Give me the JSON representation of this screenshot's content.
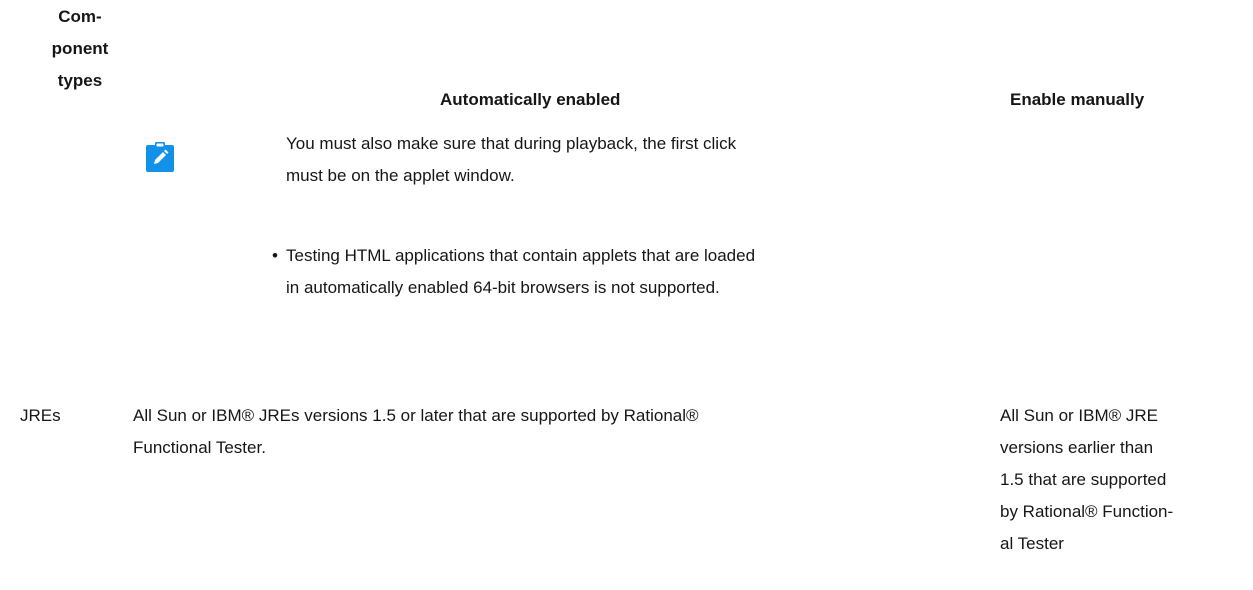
{
  "table": {
    "headers": {
      "component_types": [
        "Com-",
        "ponent",
        "types"
      ],
      "automatically_enabled": "Automatically enabled",
      "enable_manually": "Enable manually"
    },
    "note": {
      "icon": "pencil-note-icon",
      "icon_color": "#1192e8",
      "lines": [
        "You must also make sure that during playback, the first click",
        "must be on the applet window."
      ]
    },
    "bullet": {
      "marker": "•",
      "lines": [
        "Testing HTML applications that contain applets that are loaded",
        "in automatically enabled 64-bit browsers is not supported."
      ]
    },
    "rows": [
      {
        "type": "JREs",
        "auto_lines": [
          "All Sun or IBM® JREs versions 1.5 or later that are supported by Rational®",
          "Functional Tester."
        ],
        "manual_lines": [
          "All Sun or IBM® JRE",
          "versions earlier than",
          "1.5 that are supported",
          "by Rational® Function-",
          "al Tester"
        ]
      }
    ]
  }
}
